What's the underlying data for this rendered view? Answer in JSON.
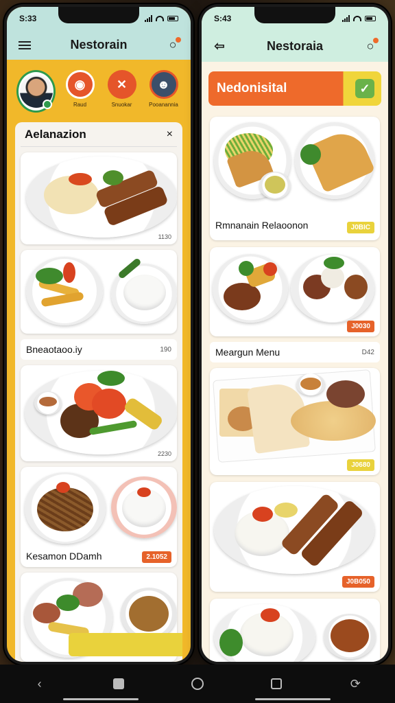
{
  "left_phone": {
    "status_time": "S:33",
    "title": "Nestorain",
    "categories": [
      {
        "label": "Raud",
        "icon": "plate-icon",
        "color": "#e5552a"
      },
      {
        "label": "Snuokar",
        "icon": "cross-icon",
        "color": "#e5552a"
      },
      {
        "label": "Pooanannia",
        "icon": "chef-icon",
        "color": "#3b4f6a"
      }
    ],
    "panel_title": "Aelanazion",
    "close_glyph": "×",
    "cards": [
      {
        "price": "1130"
      },
      {
        "price": ""
      },
      {
        "section": "Bneaotaoo.iy",
        "num": "190"
      },
      {
        "price": "2230"
      },
      {
        "title": "Kesamon DDamh",
        "price": "2.1052"
      }
    ]
  },
  "right_phone": {
    "status_time": "S:43",
    "title": "Nestoraia",
    "banner_text": "Nedonisital",
    "cards": [
      {
        "title": "Rmnanain Relaoonon",
        "price": "J0BIC"
      },
      {
        "price": "J0030"
      },
      {
        "section": "Meargun Menu",
        "num": "D42"
      },
      {
        "price": "J0680"
      },
      {
        "price": "J0B050"
      }
    ]
  },
  "colors": {
    "accent_orange": "#ee6a2b",
    "accent_yellow": "#f1b82a",
    "header_mint": "#bfe3dd",
    "check_green": "#6ab24a"
  }
}
